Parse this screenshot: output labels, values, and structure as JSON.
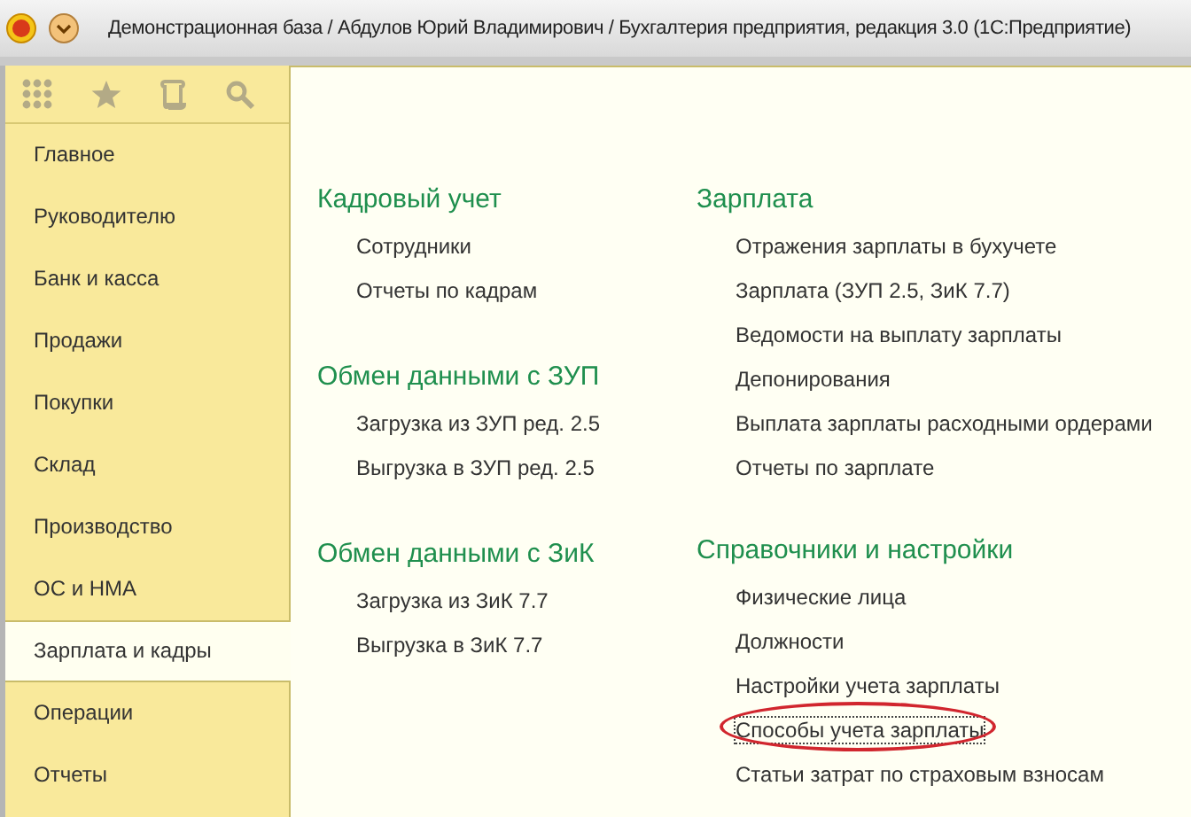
{
  "window": {
    "title": "Демонстрационная база / Абдулов Юрий Владимирович / Бухгалтерия предприятия, редакция 3.0  (1С:Предприятие)"
  },
  "sections_bar": {
    "items": [
      {
        "label": "Главное",
        "selected": false
      },
      {
        "label": "Руководителю",
        "selected": false
      },
      {
        "label": "Банк и касса",
        "selected": false
      },
      {
        "label": "Продажи",
        "selected": false
      },
      {
        "label": "Покупки",
        "selected": false
      },
      {
        "label": "Склад",
        "selected": false
      },
      {
        "label": "Производство",
        "selected": false
      },
      {
        "label": "ОС и НМА",
        "selected": false
      },
      {
        "label": "Зарплата и кадры",
        "selected": true
      },
      {
        "label": "Операции",
        "selected": false
      },
      {
        "label": "Отчеты",
        "selected": false
      }
    ]
  },
  "columns": [
    {
      "groups": [
        {
          "title": "Кадровый учет",
          "items": [
            {
              "label": "Сотрудники",
              "focused": false,
              "circled": false
            },
            {
              "label": "Отчеты по кадрам",
              "focused": false,
              "circled": false
            }
          ]
        },
        {
          "title": "Обмен данными с ЗУП",
          "items": [
            {
              "label": "Загрузка из ЗУП ред. 2.5",
              "focused": false,
              "circled": false
            },
            {
              "label": "Выгрузка в ЗУП ред. 2.5",
              "focused": false,
              "circled": false
            }
          ]
        },
        {
          "title": "Обмен данными с ЗиК",
          "items": [
            {
              "label": "Загрузка из ЗиК 7.7",
              "focused": false,
              "circled": false
            },
            {
              "label": "Выгрузка в ЗиК 7.7",
              "focused": false,
              "circled": false
            }
          ]
        }
      ]
    },
    {
      "groups": [
        {
          "title": "Зарплата",
          "items": [
            {
              "label": "Отражения зарплаты в бухучете",
              "focused": false,
              "circled": false
            },
            {
              "label": "Зарплата (ЗУП 2.5, ЗиК 7.7)",
              "focused": false,
              "circled": false
            },
            {
              "label": "Ведомости на выплату зарплаты",
              "focused": false,
              "circled": false
            },
            {
              "label": "Депонирования",
              "focused": false,
              "circled": false
            },
            {
              "label": "Выплата зарплаты расходными ордерами",
              "focused": false,
              "circled": false
            },
            {
              "label": "Отчеты по зарплате",
              "focused": false,
              "circled": false
            }
          ]
        },
        {
          "title": "Справочники и настройки",
          "items": [
            {
              "label": "Физические лица",
              "focused": false,
              "circled": false
            },
            {
              "label": "Должности",
              "focused": false,
              "circled": false
            },
            {
              "label": "Настройки учета зарплаты",
              "focused": false,
              "circled": false
            },
            {
              "label": "Способы учета зарплаты",
              "focused": true,
              "circled": true
            },
            {
              "label": "Статьи затрат по страховым взносам",
              "focused": false,
              "circled": false
            }
          ]
        }
      ]
    }
  ]
}
